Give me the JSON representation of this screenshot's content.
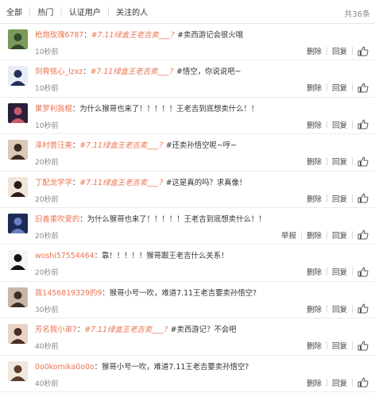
{
  "tabs": [
    "全部",
    "热门",
    "认证用户",
    "关注的人"
  ],
  "total": "共36条",
  "actions": {
    "delete": "删除",
    "reply": "回复",
    "report": "举报"
  },
  "comments": [
    {
      "user": "枪炮玫瑰6787",
      "colon": "：",
      "tag": "#7.11绿盒王老吉卖___？",
      "text": "#卖西游记会很火哦",
      "time": "10秒前",
      "report": false,
      "avatar": {
        "bg": "#7b9a5a",
        "fg": "#2e4b2a"
      }
    },
    {
      "user": "刻骨铭心_lzxz",
      "colon": "：",
      "tag": "#7.11绿盒王老吉卖___？",
      "text": "#悟空，你说说吧~",
      "time": "10秒前",
      "report": false,
      "avatar": {
        "bg": "#e9ecf5",
        "fg": "#22305a"
      }
    },
    {
      "user": "果罗利我棍",
      "colon": "：",
      "tag": "",
      "text": "为什么猴哥也来了！！！！！王老吉到底想卖什么！！",
      "time": "10秒前",
      "report": false,
      "avatar": {
        "bg": "#2a1f3a",
        "fg": "#c85a6a"
      }
    },
    {
      "user": "泽村普汪美",
      "colon": "：",
      "tag": "#7.11绿盒王老吉卖___？",
      "text": "#还卖孙悟空呢~哼~",
      "time": "20秒前",
      "report": false,
      "avatar": {
        "bg": "#d9c9b8",
        "fg": "#3a2a22"
      }
    },
    {
      "user": "丁配龙学学",
      "colon": "：",
      "tag": "#7.11绿盒王老吉卖___？",
      "text": "#这是真的吗？求真像！",
      "time": "20秒前",
      "report": false,
      "avatar": {
        "bg": "#f1e4d8",
        "fg": "#2b1d16"
      }
    },
    {
      "user": "旧善重吹爱的",
      "colon": "：",
      "tag": "",
      "text": "为什么猴哥也来了！！！！！王老吉到底想卖什么！！",
      "time": "20秒前",
      "report": true,
      "avatar": {
        "bg": "#1f2a55",
        "fg": "#6a7fc0"
      }
    },
    {
      "user": "woshi57554464",
      "colon": "：",
      "tag": "",
      "text": "靠！！！！！猴哥跟王老吉什么关系！",
      "time": "20秒前",
      "report": false,
      "avatar": {
        "bg": "#f4f4f4",
        "fg": "#111111"
      }
    },
    {
      "user": "我1456819329的9",
      "colon": "：",
      "tag": "",
      "text": "猴哥小号一吹，难道7.11王老吉要卖孙悟空?",
      "time": "30秒前",
      "report": false,
      "avatar": {
        "bg": "#c7b8a6",
        "fg": "#3d2f24"
      }
    },
    {
      "user": "芳名我小弟7",
      "colon": "：",
      "tag": "#7.11绿盒王老吉卖___？",
      "text": "#卖西游记？不会吧",
      "time": "40秒前",
      "report": false,
      "avatar": {
        "bg": "#e8d4c6",
        "fg": "#4b2f24"
      }
    },
    {
      "user": "0o0komika0o0o",
      "colon": "：",
      "tag": "",
      "text": "猴哥小号一吹，难道7.11王老吉要卖孙悟空?",
      "time": "40秒前",
      "report": false,
      "avatar": {
        "bg": "#efe6dc",
        "fg": "#5a3b2a"
      }
    }
  ]
}
